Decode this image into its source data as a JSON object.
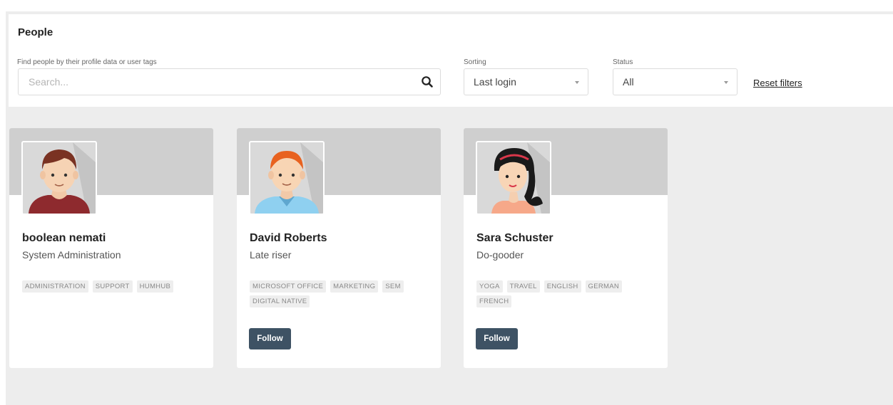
{
  "header": {
    "title": "People",
    "search_label": "Find people by their profile data or user tags",
    "search_placeholder": "Search...",
    "search_icon": "search-icon",
    "sorting_label": "Sorting",
    "sorting_value": "Last login",
    "status_label": "Status",
    "status_value": "All",
    "reset_label": "Reset filters"
  },
  "people": [
    {
      "name": "boolean nemati",
      "title": "System Administration",
      "tags": [
        "ADMINISTRATION",
        "SUPPORT",
        "HUMHUB"
      ],
      "follow_label": "",
      "avatar": "male-brown-hair-avatar"
    },
    {
      "name": "David Roberts",
      "title": "Late riser",
      "tags": [
        "MICROSOFT OFFICE",
        "MARKETING",
        "SEM",
        "DIGITAL NATIVE"
      ],
      "follow_label": "Follow",
      "avatar": "male-ginger-hair-avatar"
    },
    {
      "name": "Sara Schuster",
      "title": "Do-gooder",
      "tags": [
        "YOGA",
        "TRAVEL",
        "ENGLISH",
        "GERMAN",
        "FRENCH"
      ],
      "follow_label": "Follow",
      "avatar": "female-black-hair-avatar"
    }
  ],
  "colors": {
    "follow_button": "#3e5264",
    "banner": "#cfcfcf",
    "background": "#ededed"
  }
}
